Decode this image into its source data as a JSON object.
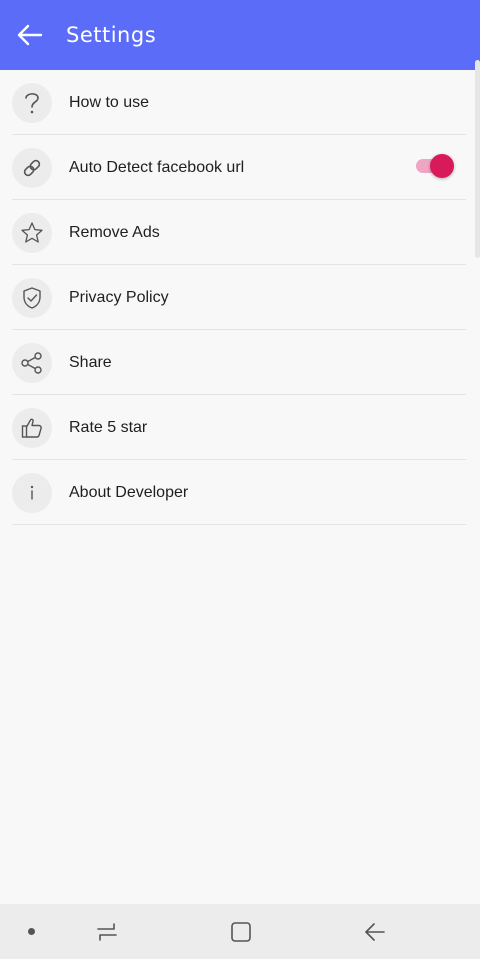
{
  "appbar": {
    "title": "Settings",
    "background_color": "#5b6df8",
    "back_icon": "arrow-left-icon"
  },
  "settings": {
    "items": [
      {
        "label": "How to use",
        "icon": "question-icon"
      },
      {
        "label": "Auto Detect facebook url",
        "icon": "link-icon",
        "toggle_on": true
      },
      {
        "label": "Remove Ads",
        "icon": "star-icon"
      },
      {
        "label": "Privacy Policy",
        "icon": "shield-check-icon"
      },
      {
        "label": "Share",
        "icon": "share-icon"
      },
      {
        "label": "Rate 5 star",
        "icon": "thumbs-up-icon"
      },
      {
        "label": "About Developer",
        "icon": "info-icon"
      }
    ],
    "accent_color": "#d91a5a"
  },
  "navbar": {
    "icons": [
      "dot-icon",
      "recent-apps-icon",
      "home-icon",
      "back-icon"
    ]
  }
}
